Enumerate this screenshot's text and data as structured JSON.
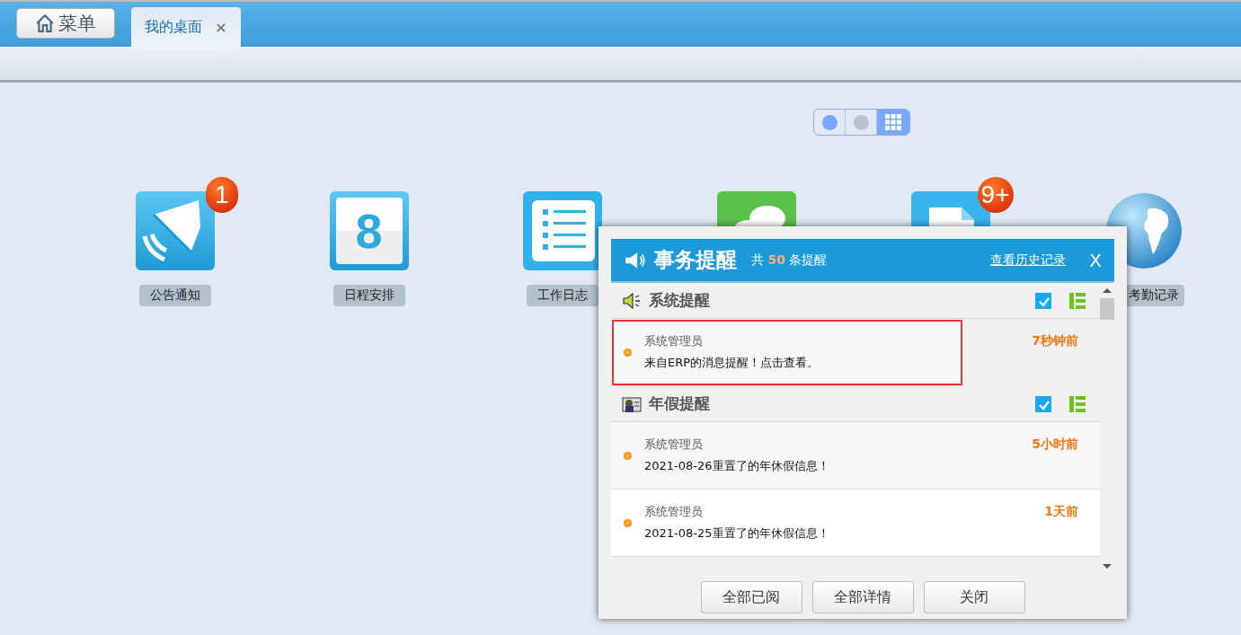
{
  "topbar": {
    "menu_button": "菜单",
    "tabs": [
      {
        "label": "我的桌面",
        "selected": true,
        "close": "×"
      }
    ]
  },
  "pager": {
    "pages": [
      {
        "selected": true
      },
      {
        "selected": false
      }
    ],
    "grid_view": {
      "selected": true
    }
  },
  "apps": [
    {
      "kind": "megaphone",
      "label": "公告通知",
      "badge": "1"
    },
    {
      "kind": "calendar",
      "label": "日程安排",
      "icon_text": "8"
    },
    {
      "kind": "list",
      "label": "工作日志"
    },
    {
      "kind": "chat"
    },
    {
      "kind": "document",
      "badge": "9+"
    },
    {
      "kind": "globe",
      "label": "考勤记录"
    }
  ],
  "dialog": {
    "title": "事务提醒",
    "count_prefix": "共",
    "count": "50",
    "count_suffix": "条提醒",
    "history_link": "查看历史记录",
    "close": "X",
    "sections": [
      {
        "kind": "system",
        "title": "系统提醒",
        "checked": true,
        "items": [
          {
            "sender": "系统管理员",
            "message": "来自ERP的消息提醒！点击查看。",
            "time": "7秒钟前",
            "highlighted": true
          }
        ]
      },
      {
        "kind": "vacation",
        "title": "年假提醒",
        "checked": true,
        "items": [
          {
            "sender": "系统管理员",
            "message": "2021-08-26重置了的年休假信息！",
            "time": "5小时前",
            "highlighted": false
          },
          {
            "sender": "系统管理员",
            "message": "2021-08-25重置了的年休假信息！",
            "time": "1天前",
            "highlighted": false
          }
        ]
      }
    ],
    "buttons": [
      "全部已阅",
      "全部详情",
      "关闭"
    ]
  }
}
